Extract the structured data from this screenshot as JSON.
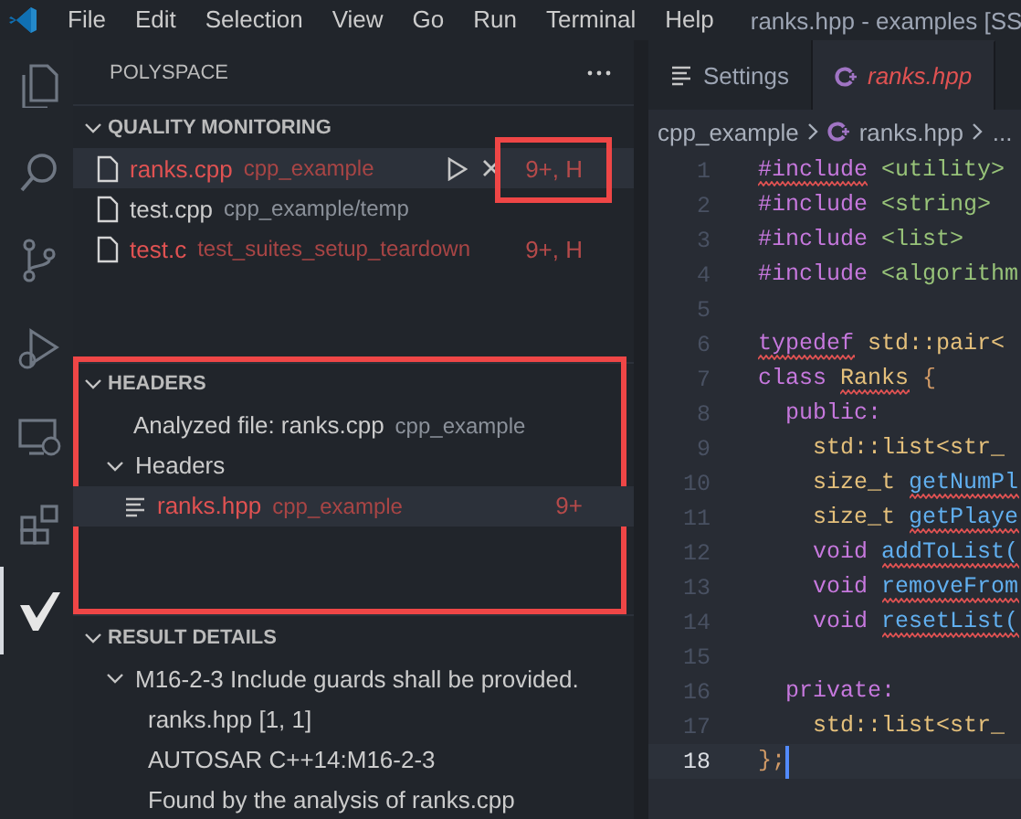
{
  "title_bar": {
    "menu": [
      "File",
      "Edit",
      "Selection",
      "View",
      "Go",
      "Run",
      "Terminal",
      "Help"
    ],
    "title": "ranks.hpp - examples [SS"
  },
  "activity_bar": [
    {
      "kind": "files",
      "selected": false
    },
    {
      "kind": "search",
      "selected": false
    },
    {
      "kind": "source-control",
      "selected": false
    },
    {
      "kind": "run",
      "selected": false
    },
    {
      "kind": "remote",
      "selected": false
    },
    {
      "kind": "extensions",
      "selected": false
    },
    {
      "kind": "polyspace",
      "selected": true
    }
  ],
  "sidebar": {
    "title": "POLYSPACE",
    "sections": [
      {
        "title": "QUALITY MONITORING",
        "expanded": true,
        "highlighted": false,
        "items": [
          {
            "kind": "source-file",
            "name": "ranks.cpp",
            "description": "cpp_example",
            "badge": "9+, H",
            "error": true,
            "selected": true,
            "badge_highlighted": true
          },
          {
            "kind": "source-file",
            "name": "test.cpp",
            "description": "cpp_example/temp",
            "error": false,
            "selected": false,
            "badge_highlighted": false
          },
          {
            "kind": "source-file",
            "name": "test.c",
            "description": "test_suites_setup_teardown",
            "badge": "9+, H",
            "error": true,
            "selected": false,
            "badge_highlighted": false
          }
        ]
      },
      {
        "title": "HEADERS",
        "expanded": true,
        "highlighted": true,
        "items": [
          {
            "kind": "text",
            "label": "Analyzed file: ranks.cpp",
            "description": "cpp_example"
          },
          {
            "kind": "group",
            "label": "Headers",
            "expanded": true,
            "children": [
              {
                "kind": "header-file",
                "name": "ranks.hpp",
                "description": "cpp_example",
                "badge": "9+",
                "error": true,
                "selected": true,
                "badge_highlighted": false
              }
            ]
          }
        ]
      },
      {
        "title": "RESULT DETAILS",
        "expanded": true,
        "highlighted": false,
        "items": [
          {
            "kind": "group",
            "label": "M16-2-3 Include guards shall be provided.",
            "expanded": true,
            "children": [
              {
                "kind": "text",
                "label": "ranks.hpp [1, 1]"
              },
              {
                "kind": "text",
                "label": "AUTOSAR C++14:M16-2-3"
              },
              {
                "kind": "text",
                "label": "Found by the analysis of ranks.cpp"
              }
            ]
          }
        ]
      }
    ]
  },
  "editor": {
    "tabs": [
      {
        "kind": "settings",
        "label": "Settings",
        "selected": false,
        "error": false
      },
      {
        "kind": "cpp",
        "label": "ranks.hpp",
        "selected": true,
        "error": true
      }
    ],
    "breadcrumbs": [
      {
        "kind": "folder",
        "label": "cpp_example"
      },
      {
        "kind": "cpp",
        "label": "ranks.hpp"
      },
      {
        "kind": "more",
        "label": "..."
      }
    ],
    "lines": [
      {
        "number": "1",
        "current": false,
        "kind": "top",
        "tokens": [
          {
            "kind": "directive",
            "text": "#include",
            "squiggle": true
          },
          {
            "kind": "header",
            "text": "<utility>",
            "squiggle": false
          }
        ]
      },
      {
        "number": "2",
        "current": false,
        "kind": "top",
        "tokens": [
          {
            "kind": "directive",
            "text": "#include",
            "squiggle": false
          },
          {
            "kind": "header",
            "text": "<string>",
            "squiggle": false
          }
        ]
      },
      {
        "number": "3",
        "current": false,
        "kind": "top",
        "tokens": [
          {
            "kind": "directive",
            "text": "#include",
            "squiggle": false
          },
          {
            "kind": "header",
            "text": "<list>",
            "squiggle": false
          }
        ]
      },
      {
        "number": "4",
        "current": false,
        "kind": "top",
        "tokens": [
          {
            "kind": "directive",
            "text": "#include",
            "squiggle": false
          },
          {
            "kind": "header",
            "text": "<algorithm",
            "squiggle": false
          }
        ]
      },
      {
        "number": "5",
        "current": false
      },
      {
        "number": "6",
        "current": false,
        "kind": "top",
        "tokens": [
          {
            "kind": "keyword",
            "text": "typedef",
            "squiggle": true
          },
          {
            "kind": "type",
            "text": "std::pair<",
            "squiggle": false
          }
        ]
      },
      {
        "number": "7",
        "current": false,
        "kind": "top",
        "tokens": [
          {
            "kind": "keyword",
            "text": "class",
            "squiggle": false
          },
          {
            "kind": "type",
            "text": "Ranks",
            "squiggle": true
          },
          {
            "kind": "brace",
            "text": "{",
            "squiggle": false
          }
        ]
      },
      {
        "number": "8",
        "current": false,
        "kind": "class",
        "tokens": [
          {
            "kind": "keyword",
            "text": "public:",
            "squiggle": false
          }
        ]
      },
      {
        "number": "9",
        "current": false,
        "kind": "member",
        "tokens": [
          {
            "kind": "type",
            "text": "std::list<str_",
            "squiggle": false
          }
        ]
      },
      {
        "number": "10",
        "current": false,
        "kind": "member",
        "tokens": [
          {
            "kind": "type",
            "text": "size_t",
            "squiggle": false
          },
          {
            "kind": "function",
            "text": "getNumPl",
            "squiggle": true
          }
        ]
      },
      {
        "number": "11",
        "current": false,
        "kind": "member",
        "tokens": [
          {
            "kind": "type",
            "text": "size_t",
            "squiggle": false
          },
          {
            "kind": "function",
            "text": "getPlaye",
            "squiggle": true
          }
        ]
      },
      {
        "number": "12",
        "current": false,
        "kind": "member",
        "tokens": [
          {
            "kind": "keyword",
            "text": "void",
            "squiggle": false
          },
          {
            "kind": "function",
            "text": "addToList(",
            "squiggle": true
          }
        ]
      },
      {
        "number": "13",
        "current": false,
        "kind": "member",
        "tokens": [
          {
            "kind": "keyword",
            "text": "void",
            "squiggle": false
          },
          {
            "kind": "function",
            "text": "removeFrom",
            "squiggle": true
          }
        ]
      },
      {
        "number": "14",
        "current": false,
        "kind": "member",
        "tokens": [
          {
            "kind": "keyword",
            "text": "void",
            "squiggle": false
          },
          {
            "kind": "function",
            "text": "resetList(",
            "squiggle": true
          }
        ]
      },
      {
        "number": "15",
        "current": false
      },
      {
        "number": "16",
        "current": false,
        "kind": "class",
        "tokens": [
          {
            "kind": "keyword",
            "text": "private:",
            "squiggle": false
          }
        ]
      },
      {
        "number": "17",
        "current": false,
        "kind": "member",
        "tokens": [
          {
            "kind": "type",
            "text": "std::list<str_",
            "squiggle": false
          }
        ]
      },
      {
        "number": "18",
        "current": true,
        "kind": "top",
        "tokens": [
          {
            "kind": "brace",
            "text": "};",
            "squiggle": false
          }
        ]
      }
    ]
  }
}
